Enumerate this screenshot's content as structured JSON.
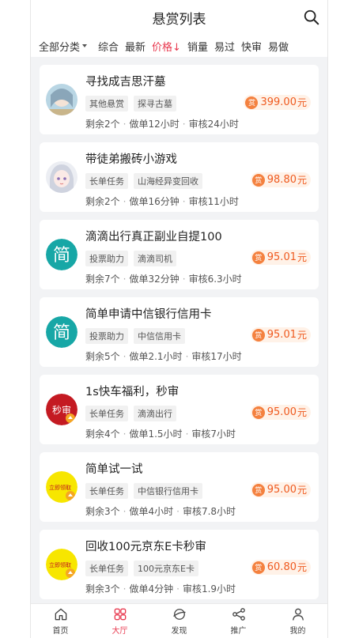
{
  "header": {
    "title": "悬赏列表"
  },
  "filters": {
    "category": "全部分类",
    "items": [
      {
        "label": "综合",
        "active": false
      },
      {
        "label": "最新",
        "active": false
      },
      {
        "label": "价格↓",
        "active": true
      },
      {
        "label": "销量",
        "active": false
      },
      {
        "label": "易过",
        "active": false
      },
      {
        "label": "快审",
        "active": false
      },
      {
        "label": "易做",
        "active": false
      }
    ]
  },
  "tasks": [
    {
      "title": "寻找成吉思汗墓",
      "tags": [
        "其他悬赏",
        "探寻古墓"
      ],
      "price": "399.00",
      "unit": "元",
      "remaining": "剩余2个",
      "do_time": "做单12小时",
      "review": "审核24小时",
      "avatar": "anime-girl-1"
    },
    {
      "title": "带徒弟搬砖小游戏",
      "tags": [
        "长单任务",
        "山海经异变回收"
      ],
      "price": "98.80",
      "unit": "元",
      "remaining": "剩余2个",
      "do_time": "做单16分钟",
      "review": "审核11小时",
      "avatar": "anime-girl-2"
    },
    {
      "title": "滴滴出行真正副业自提100",
      "tags": [
        "投票助力",
        "滴滴司机"
      ],
      "price": "95.01",
      "unit": "元",
      "remaining": "剩余7个",
      "do_time": "做单32分钟",
      "review": "审核6.3小时",
      "avatar": "jian-logo",
      "avatar_text": "简"
    },
    {
      "title": "简单申请中信银行信用卡",
      "tags": [
        "投票助力",
        "中信信用卡"
      ],
      "price": "95.01",
      "unit": "元",
      "remaining": "剩余5个",
      "do_time": "做单2.1小时",
      "review": "审核17小时",
      "avatar": "jian-logo",
      "avatar_text": "简"
    },
    {
      "title": "1s快车福利，秒审",
      "tags": [
        "长单任务",
        "滴滴出行"
      ],
      "price": "95.00",
      "unit": "元",
      "remaining": "剩余4个",
      "do_time": "做单1.5小时",
      "review": "审核7小时",
      "avatar": "miaoshen-logo",
      "avatar_text": "秒审"
    },
    {
      "title": "简单试一试",
      "tags": [
        "长单任务",
        "中信银行信用卡"
      ],
      "price": "95.00",
      "unit": "元",
      "remaining": "剩余3个",
      "do_time": "做单4小时",
      "review": "审核7.8小时",
      "avatar": "lijilingqu-logo",
      "avatar_text": "立即领取"
    },
    {
      "title": "回收100元京东E卡秒审",
      "tags": [
        "长单任务",
        "100元京东E卡"
      ],
      "price": "60.80",
      "unit": "元",
      "remaining": "剩余3个",
      "do_time": "做单4分钟",
      "review": "审核1.9小时",
      "avatar": "lijilingqu-logo",
      "avatar_text": "立即领取"
    }
  ],
  "coin_label": "赏",
  "tabbar": [
    {
      "label": "首页",
      "icon": "home-icon",
      "active": false
    },
    {
      "label": "大厅",
      "icon": "hall-icon",
      "active": true
    },
    {
      "label": "发现",
      "icon": "discover-icon",
      "active": false
    },
    {
      "label": "推广",
      "icon": "share-icon",
      "active": false
    },
    {
      "label": "我的",
      "icon": "user-icon",
      "active": false
    }
  ],
  "colors": {
    "accent": "#e8394f",
    "price": "#ef5a1f",
    "coin": "#f4813f"
  }
}
